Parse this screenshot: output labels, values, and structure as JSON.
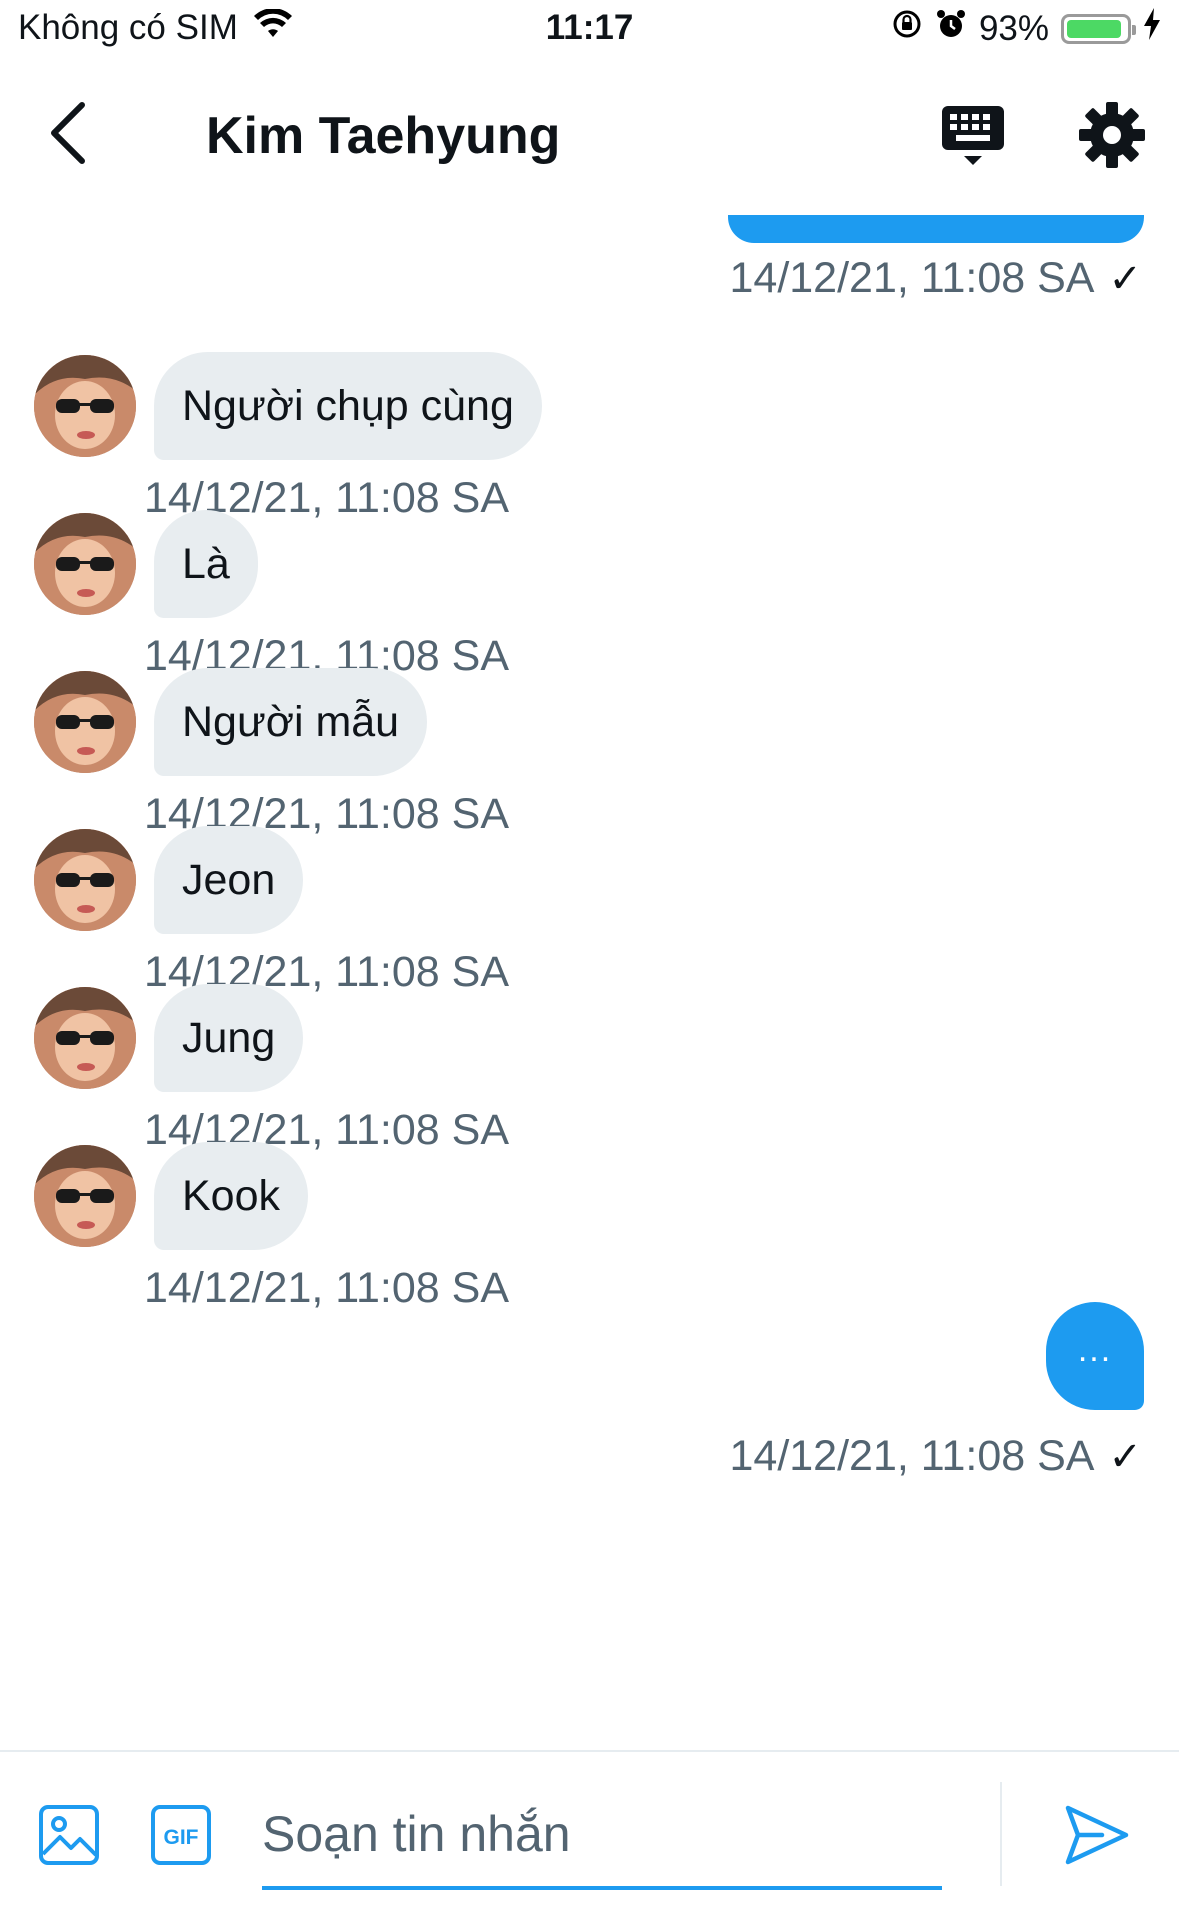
{
  "status_bar": {
    "carrier": "Không có SIM",
    "time": "11:17",
    "battery_percent": "93%",
    "battery_level": 0.93,
    "icons": [
      "wifi-icon",
      "rotation-lock-icon",
      "alarm-icon",
      "battery-icon",
      "charging-bolt-icon"
    ]
  },
  "header": {
    "title": "Kim Taehyung",
    "icons": [
      "back-chevron-icon",
      "keyboard-icon",
      "gear-icon"
    ]
  },
  "conversation": {
    "top_outgoing_timestamp": "14/12/21, 11:08 SA",
    "incoming": [
      {
        "text": "Người chụp cùng",
        "timestamp": "14/12/21, 11:08 SA"
      },
      {
        "text": "Là",
        "timestamp": "14/12/21, 11:08 SA"
      },
      {
        "text": "Người mẫu",
        "timestamp": "14/12/21, 11:08 SA"
      },
      {
        "text": "Jeon",
        "timestamp": "14/12/21, 11:08 SA"
      },
      {
        "text": "Jung",
        "timestamp": "14/12/21, 11:08 SA"
      },
      {
        "text": "Kook",
        "timestamp": "14/12/21, 11:08 SA"
      }
    ],
    "outgoing_last": {
      "text": "...",
      "timestamp": "14/12/21, 11:08 SA"
    },
    "read_mark": "✓"
  },
  "compose": {
    "placeholder": "Soạn tin nhắn",
    "value": "",
    "icons": [
      "image-icon",
      "gif-icon",
      "send-icon"
    ]
  },
  "colors": {
    "accent": "#1d9bf0",
    "incoming_bubble": "#e8edf0",
    "timestamp_text": "#536471",
    "battery_fill": "#4cd964"
  }
}
